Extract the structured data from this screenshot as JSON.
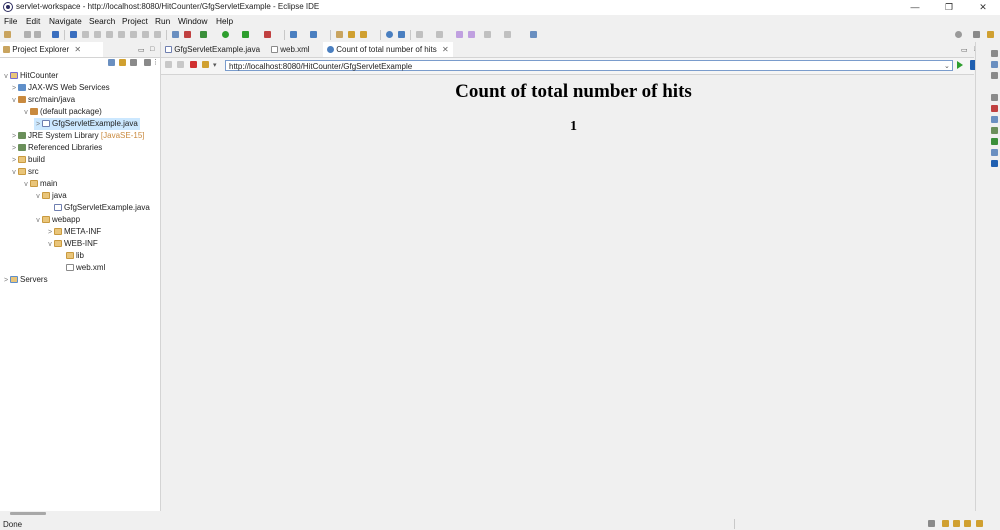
{
  "window": {
    "title": "servlet-workspace - http://localhost:8080/HitCounter/GfgServletExample - Eclipse IDE",
    "minimize": "—",
    "maximize": "❐",
    "close": "✕"
  },
  "menu": [
    "File",
    "Edit",
    "Navigate",
    "Search",
    "Project",
    "Run",
    "Window",
    "Help"
  ],
  "explorer": {
    "tab_label": "Project Explorer",
    "close": "✕",
    "tree": [
      {
        "label": "HitCounter",
        "chev": "v"
      },
      {
        "label": "JAX-WS Web Services",
        "chev": ">"
      },
      {
        "label": "src/main/java",
        "chev": "v"
      },
      {
        "label": "(default package)",
        "chev": "v"
      },
      {
        "label": "GfgServletExample.java",
        "chev": ">"
      },
      {
        "label": "JRE System Library",
        "chev": ">",
        "decoration": "[JavaSE-15]"
      },
      {
        "label": "Referenced Libraries",
        "chev": ">"
      },
      {
        "label": "build",
        "chev": ">"
      },
      {
        "label": "src",
        "chev": "v"
      },
      {
        "label": "main",
        "chev": "v"
      },
      {
        "label": "java",
        "chev": "v"
      },
      {
        "label": "GfgServletExample.java",
        "chev": ""
      },
      {
        "label": "webapp",
        "chev": "v"
      },
      {
        "label": "META-INF",
        "chev": ">"
      },
      {
        "label": "WEB-INF",
        "chev": "v"
      },
      {
        "label": "lib",
        "chev": ""
      },
      {
        "label": "web.xml",
        "chev": ""
      },
      {
        "label": "Servers",
        "chev": ">"
      }
    ]
  },
  "editor_tabs": [
    {
      "label": "GfgServletExample.java"
    },
    {
      "label": "web.xml"
    },
    {
      "label": "Count of total number of hits",
      "close": "✕"
    }
  ],
  "browser": {
    "url": "http://localhost:8080/HitCounter/GfgServletExample",
    "heading": "Count of total number of hits",
    "count": "1"
  },
  "status": {
    "text": "Done"
  },
  "colors": {
    "selection": "#cce8ff",
    "url_border": "#7a9ccc",
    "run_green": "#2e9e2e",
    "stop_red": "#d03030"
  }
}
